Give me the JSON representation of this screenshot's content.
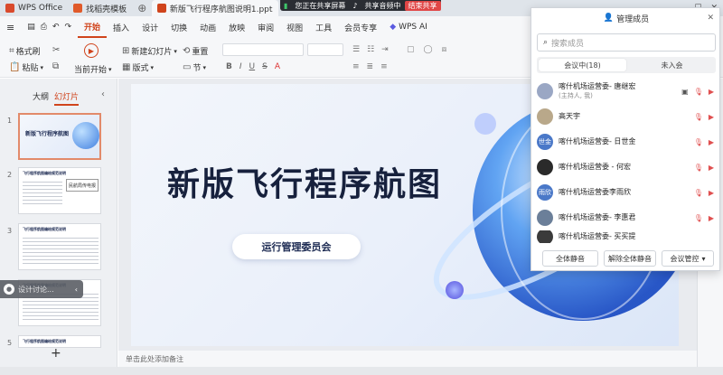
{
  "titlebar": {
    "tabs": [
      {
        "label": "WPS Office",
        "color": "#d94a2c"
      },
      {
        "label": "找稻壳模板",
        "color": "#e05a2a"
      },
      {
        "label": "新版飞行程序航图说明1.pptx",
        "color": "#d0441c"
      }
    ]
  },
  "sharebar": {
    "sharing": "您正在共享屏幕",
    "audio": "共享音频中",
    "end": "结束共享"
  },
  "menubar": {
    "items": [
      "开始",
      "插入",
      "设计",
      "切换",
      "动画",
      "放映",
      "审阅",
      "视图",
      "工具",
      "会员专享",
      "WPS AI"
    ],
    "active": "开始"
  },
  "ribbon": {
    "format_brush": "格式刷",
    "paste": "粘贴",
    "from_current": "当前开始",
    "new_slide": "新建幻灯片",
    "layout": "版式",
    "reset": "重置",
    "section": "节"
  },
  "leftpanel": {
    "tab_outline": "大纲",
    "tab_slides": "幻灯片",
    "thumbs": [
      {
        "num": "1",
        "title": "新版飞行程序航图"
      },
      {
        "num": "2",
        "title": "飞行程序航图编绘规范说明",
        "stamp": "民航局传电报"
      },
      {
        "num": "3",
        "title": "飞行程序航图编绘规范说明"
      },
      {
        "num": "4",
        "title": "飞行程序航图编绘规范说明"
      },
      {
        "num": "5",
        "title": "飞行程序航图编绘规范说明"
      }
    ],
    "add": "+"
  },
  "floatctl": {
    "label": "设计讨论..."
  },
  "slide": {
    "title": "新版飞行程序航图",
    "subtitle": "运行管理委员会"
  },
  "notes": {
    "placeholder": "单击此处添加备注"
  },
  "meeting": {
    "title": "管理成员",
    "search_placeholder": "搜索成员",
    "tab_in": "会议中(18)",
    "tab_out": "未入会",
    "members": [
      {
        "name": "喀什机场运营委- 唐继宏",
        "sub": "(主持人, 我)",
        "avatar": "",
        "color": "#9aa7c4"
      },
      {
        "name": "高天宇",
        "sub": "",
        "avatar": "",
        "color": "#b9a88a"
      },
      {
        "name": "喀什机场运营委- 日世金",
        "sub": "",
        "avatar": "世金",
        "color": "#4a78c8"
      },
      {
        "name": "喀什机场运营委 - 何宏",
        "sub": "",
        "avatar": "",
        "color": "#2a2a2a"
      },
      {
        "name": "喀什机场运营委李雨欣",
        "sub": "",
        "avatar": "雨欣",
        "color": "#4a78c8"
      },
      {
        "name": "喀什机场运营委- 李惠君",
        "sub": "",
        "avatar": "",
        "color": "#6b7f99"
      },
      {
        "name": "喀什机场运营委- 买买提",
        "sub": "",
        "avatar": "",
        "color": "#3a3a3a"
      }
    ],
    "mute_all": "全体静音",
    "unmute_all": "解除全体静音",
    "control": "会议管控"
  }
}
